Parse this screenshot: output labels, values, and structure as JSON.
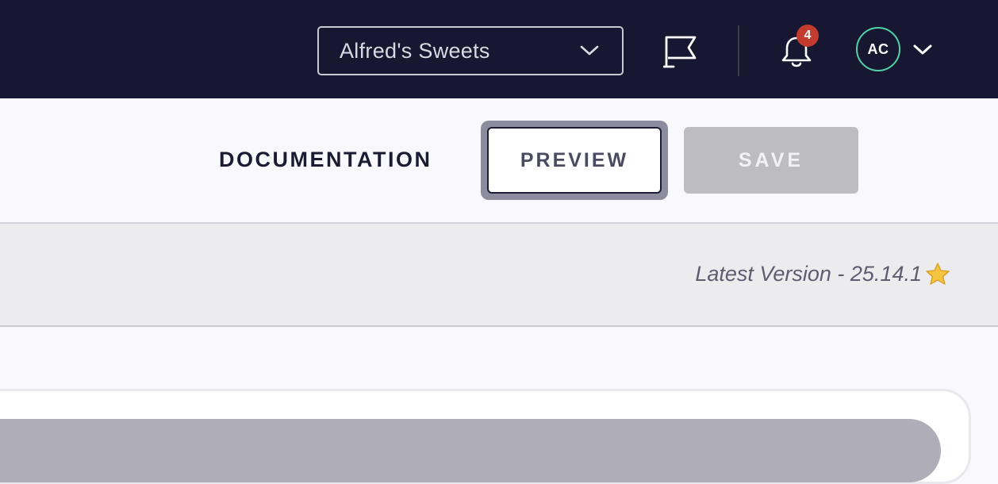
{
  "header": {
    "org_selector": {
      "value": "Alfred's Sweets"
    },
    "notifications": {
      "count": "4"
    },
    "user": {
      "initials": "AC"
    }
  },
  "actions": {
    "documentation_label": "DOCUMENTATION",
    "preview_label": "PREVIEW",
    "save_label": "SAVE"
  },
  "version": {
    "text": "Latest Version - 25.14.1"
  },
  "icons": {
    "org_chevron": "chevron-down-icon",
    "flag": "flag-icon",
    "bell": "bell-icon",
    "user_chevron": "chevron-down-icon",
    "star": "star-icon"
  },
  "colors": {
    "topbar": "#171731",
    "badge": "#c23b2f",
    "avatar_ring": "#52d1a6",
    "save_disabled": "#bdbcc1",
    "star": "#f5c542"
  }
}
